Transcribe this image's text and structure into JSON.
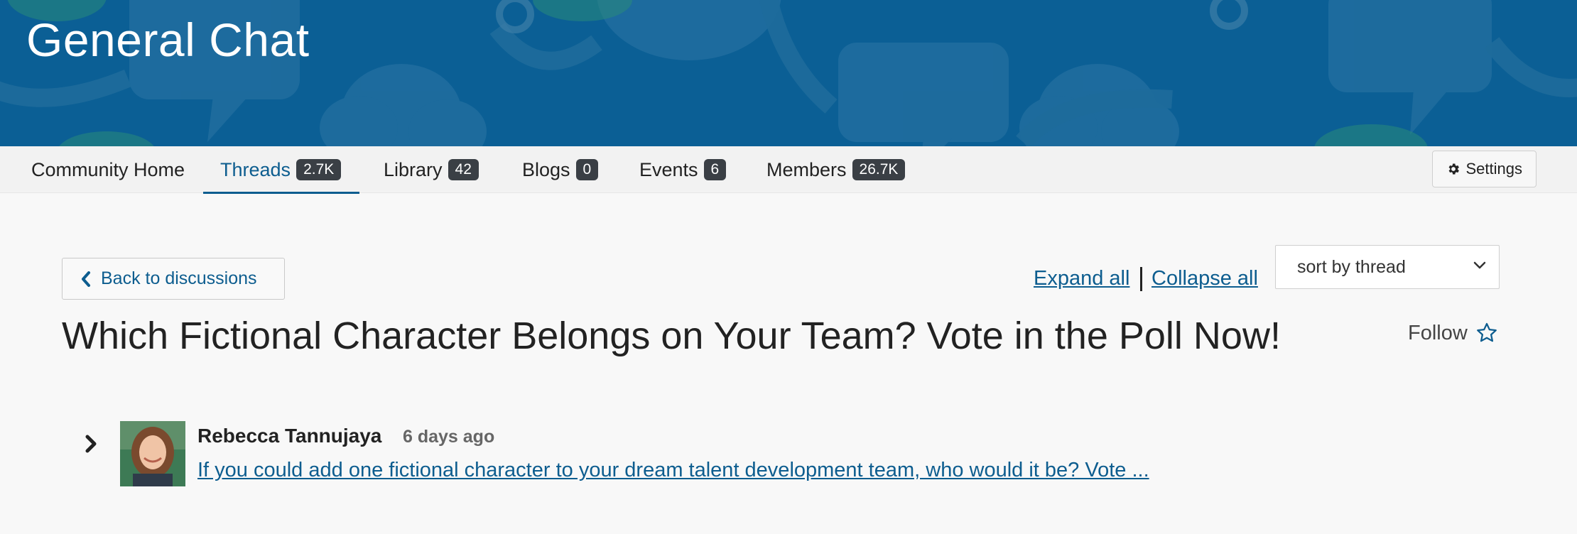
{
  "banner": {
    "title": "General Chat"
  },
  "nav": {
    "items": [
      {
        "label": "Community Home",
        "count": ""
      },
      {
        "label": "Threads",
        "count": "2.7K"
      },
      {
        "label": "Library",
        "count": "42"
      },
      {
        "label": "Blogs",
        "count": "0"
      },
      {
        "label": "Events",
        "count": "6"
      },
      {
        "label": "Members",
        "count": "26.7K"
      }
    ],
    "settings_label": "Settings"
  },
  "controls": {
    "back_label": "Back to discussions",
    "expand_label": "Expand all",
    "collapse_label": "Collapse all",
    "sort_selected": "sort by thread"
  },
  "thread": {
    "title": "Which Fictional Character Belongs on Your Team? Vote in the Poll Now!",
    "follow_label": "Follow"
  },
  "post": {
    "author": "Rebecca Tannujaya",
    "time": "6 days ago",
    "excerpt": "If you could add one fictional character to your dream talent development team, who would it be? Vote ..."
  },
  "colors": {
    "banner_bg": "#0b5f95",
    "link": "#0d5d8f",
    "badge_bg": "#3a3f45"
  }
}
